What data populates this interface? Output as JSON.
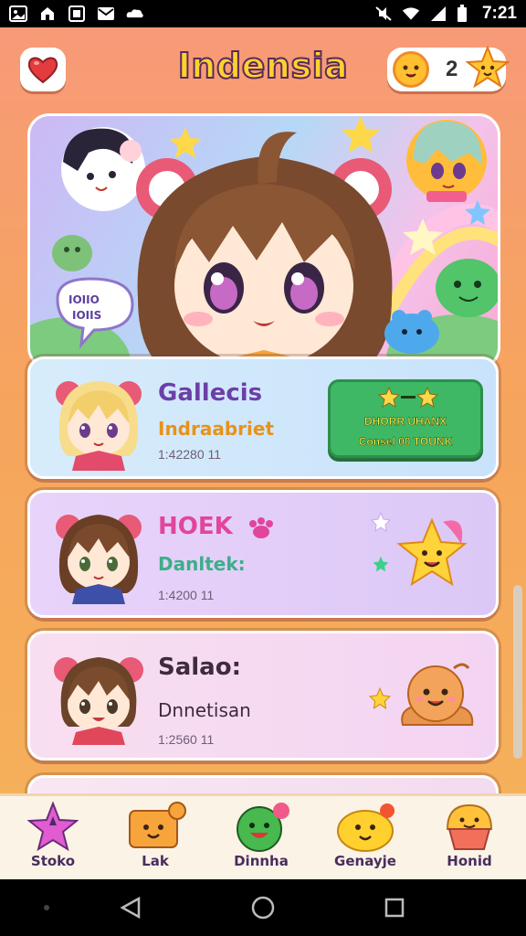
{
  "status_bar": {
    "time": "7:21",
    "left_icons": [
      "photo-icon",
      "app-notification-icon",
      "app-icon",
      "mail-icon",
      "cloud-icon"
    ],
    "right_icons": [
      "muted-icon",
      "wifi-icon",
      "signal-icon",
      "battery-icon"
    ]
  },
  "header": {
    "title": "Indensia",
    "coin_count": "2"
  },
  "cards": [
    {
      "name": "Gallecis",
      "subtitle": "Indraabriet",
      "meta": "1:42280 11",
      "reward": {
        "line1": "DHORR UHANX",
        "line2": "Consel 00 TOUNK"
      }
    },
    {
      "name": "HOEK",
      "subtitle": "Danltek:",
      "meta": "1:4200 11"
    },
    {
      "name": "Salao:",
      "subtitle": "Dnnetisan",
      "meta": "1:2560 11"
    }
  ],
  "bottom_nav": [
    {
      "label": "Stoko",
      "icon": "star-badge-icon"
    },
    {
      "label": "Lak",
      "icon": "letter-box-icon"
    },
    {
      "label": "Dinnha",
      "icon": "green-blob-icon"
    },
    {
      "label": "Genayje",
      "icon": "yellow-chick-icon"
    },
    {
      "label": "Honid",
      "icon": "cupcake-icon"
    }
  ],
  "colors": {
    "background_top": "#f79a78",
    "background_bottom": "#f5b25a",
    "title": "#ffd12e",
    "reward_button": "#3fb866"
  }
}
